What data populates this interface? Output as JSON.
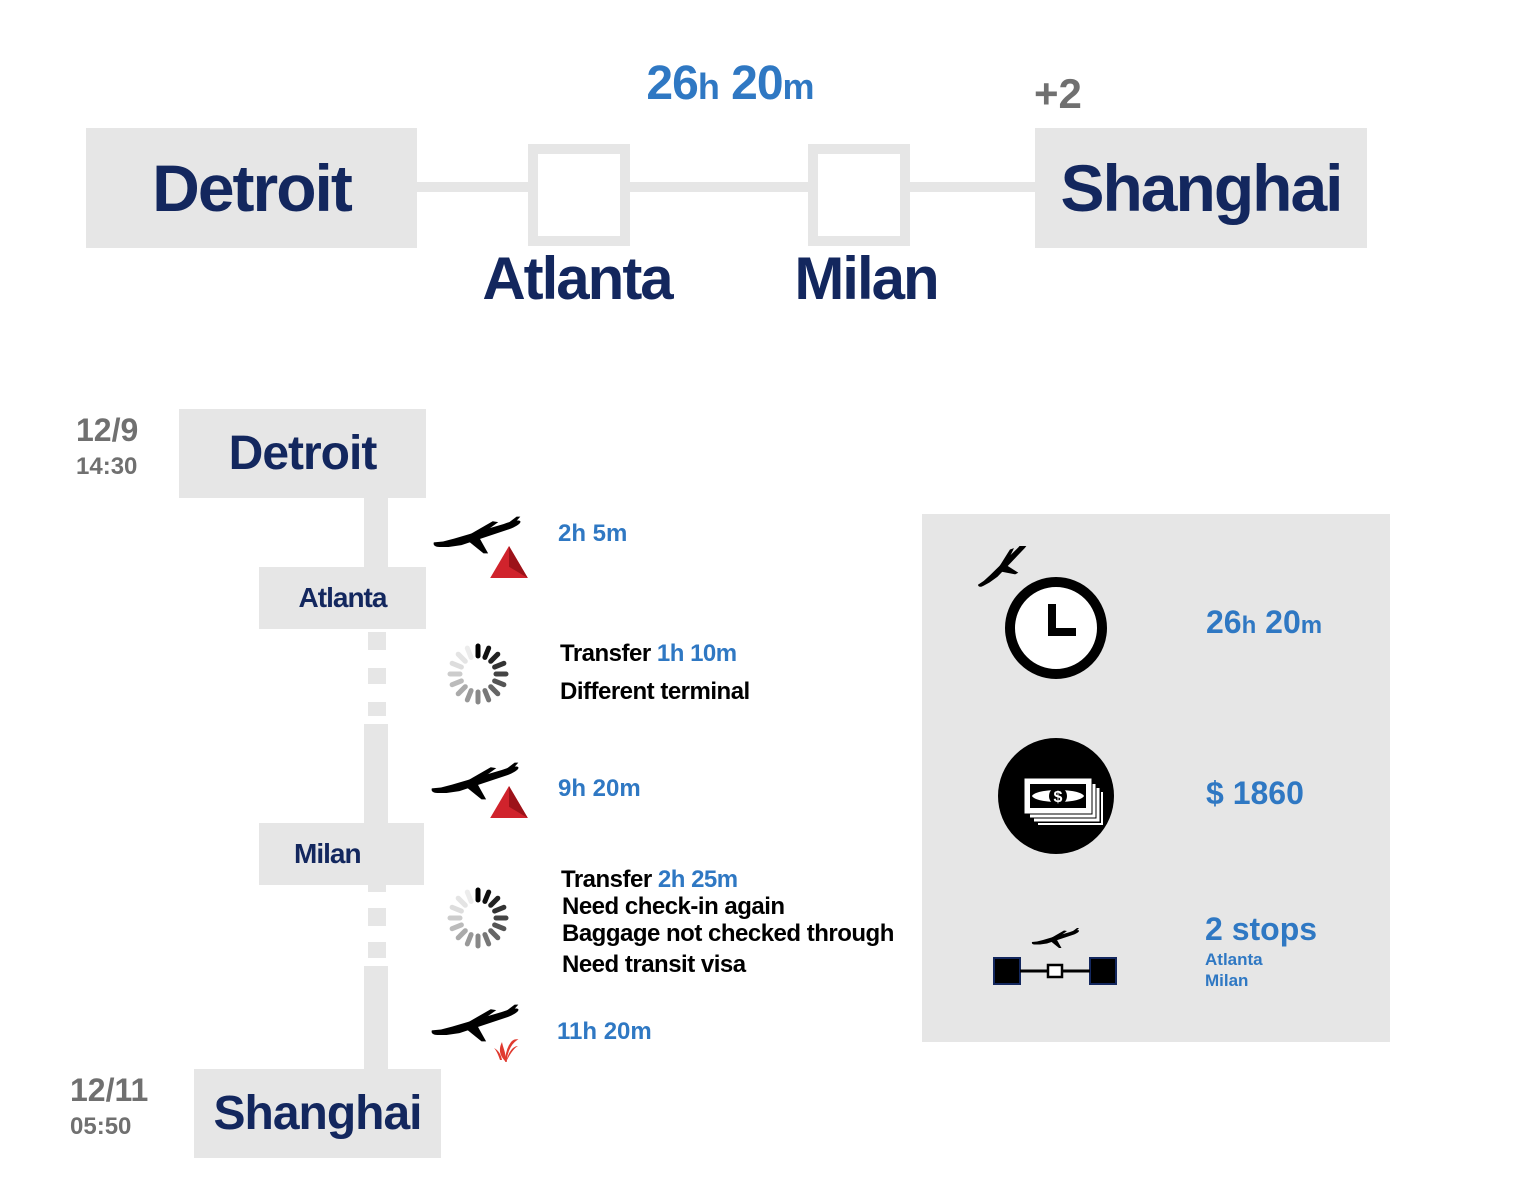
{
  "route": {
    "origin": "Detroit",
    "destination": "Shanghai",
    "day_offset": "+2",
    "stops": [
      "Atlanta",
      "Milan"
    ],
    "total_hours": "26",
    "hours_unit": "h",
    "total_minutes": "20",
    "minutes_unit": "m"
  },
  "timeline": {
    "departure": {
      "date": "12/9",
      "time": "14:30",
      "city": "Detroit"
    },
    "arrival": {
      "date": "12/11",
      "time": "05:50",
      "city": "Shanghai"
    },
    "stops": [
      "Atlanta",
      "Milan"
    ],
    "legs": [
      {
        "duration": "2h 5m",
        "airline_icon": "delta-logo-icon"
      },
      {
        "duration": "9h 20m",
        "airline_icon": "delta-logo-icon"
      },
      {
        "duration": "11h 20m",
        "airline_icon": "air-china-logo-icon"
      }
    ],
    "transfers": [
      {
        "label": "Transfer",
        "duration": "1h 10m",
        "notes": [
          "Different terminal"
        ]
      },
      {
        "label": "Transfer",
        "duration": "2h 25m",
        "notes": [
          "Need check-in again",
          "Baggage not checked through",
          "Need transit visa"
        ]
      }
    ]
  },
  "summary": {
    "duration_hours": "26",
    "hours_unit": "h",
    "duration_minutes": "20",
    "minutes_unit": "m",
    "price": "$ 1860",
    "stops_label": "2 stops",
    "stops_list": [
      "Atlanta",
      "Milan"
    ],
    "icons": [
      "plane-clock-icon",
      "money-icon",
      "stops-route-icon"
    ]
  },
  "colors": {
    "navy": "#13275e",
    "blue": "#2f78c3",
    "grey": "#707070",
    "box": "#e6e6e6",
    "delta_red": "#d0232c",
    "air_china_red": "#e03a2f"
  }
}
